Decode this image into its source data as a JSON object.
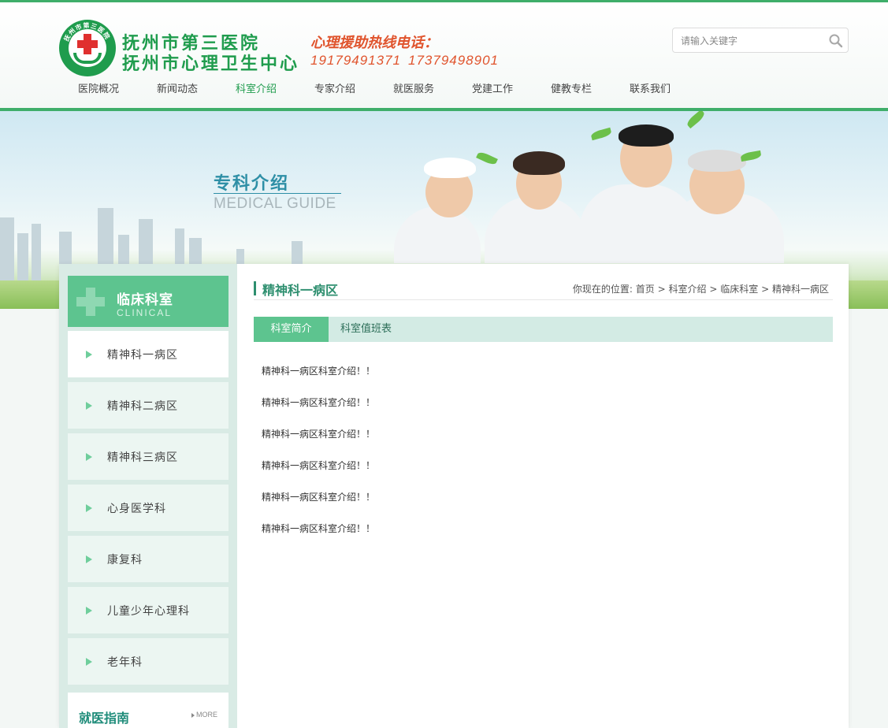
{
  "header": {
    "logo_ring_text": "抚州市第三医院",
    "name_line1": "抚州市第三医院",
    "name_line2": "抚州市心理卫生中心",
    "hotline_label": "心理援助热线电话：",
    "hotline_numbers": [
      "19179491371",
      "17379498901"
    ],
    "search_placeholder": "请输入关键字"
  },
  "nav": {
    "items": [
      "医院概况",
      "新闻动态",
      "科室介绍",
      "专家介绍",
      "就医服务",
      "党建工作",
      "健教专栏",
      "联系我们"
    ],
    "active_index": 2
  },
  "banner": {
    "title": "专科介绍",
    "subtitle": "MEDICAL GUIDE"
  },
  "sidebar": {
    "title": "临床科室",
    "subtitle": "CLINICAL",
    "items": [
      "精神科一病区",
      "精神科二病区",
      "精神科三病区",
      "心身医学科",
      "康复科",
      "儿童少年心理科",
      "老年科"
    ],
    "active_index": 0,
    "guide_title": "就医指南",
    "guide_more": "MORE"
  },
  "main": {
    "title": "精神科一病区",
    "breadcrumb": {
      "prefix": "你现在的位置:",
      "items": [
        "首页",
        "科室介绍",
        "临床科室",
        "精神科一病区"
      ],
      "separator": ">"
    },
    "tabs": [
      "科室简介",
      "科室值班表"
    ],
    "active_tab": 0,
    "paragraphs": [
      "精神科一病区科室介绍！！",
      "精神科一病区科室介绍！！",
      "精神科一病区科室介绍！！",
      "精神科一病区科室介绍！！",
      "精神科一病区科室介绍！！",
      "精神科一病区科室介绍！！"
    ]
  },
  "colors": {
    "brand_green": "#1f9c4d",
    "accent_green": "#5dc48f",
    "hotline_orange": "#e0542d",
    "banner_title_teal": "#2e8fa6"
  }
}
